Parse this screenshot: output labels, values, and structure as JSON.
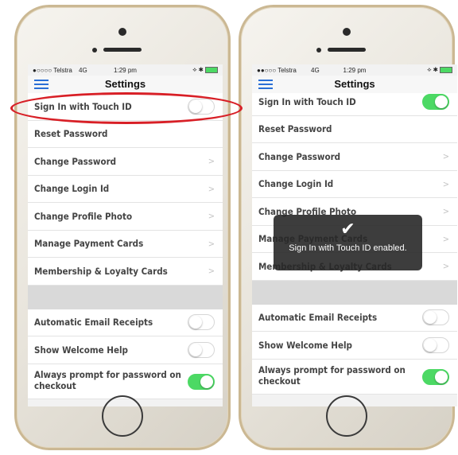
{
  "status": {
    "carrier": "●○○○○ Telstra",
    "network": "4G",
    "time": "1:29 pm",
    "icons": "⟡ ✱"
  },
  "status_right": {
    "carrier": "●●○○○ Telstra",
    "network": "4G",
    "time": "1:29 pm"
  },
  "navbar": {
    "title": "Settings"
  },
  "rows_left": [
    {
      "label": "Sign In with Touch ID",
      "control": "toggle-off"
    },
    {
      "label": "Reset Password",
      "control": "none"
    },
    {
      "label": "Change Password",
      "control": "chevron"
    },
    {
      "label": "Change Login Id",
      "control": "chevron"
    },
    {
      "label": "Change Profile Photo",
      "control": "chevron"
    },
    {
      "label": "Manage Payment Cards",
      "control": "chevron"
    },
    {
      "label": "Membership & Loyalty Cards",
      "control": "chevron"
    },
    {
      "label": "Automatic Email Receipts",
      "control": "toggle-off"
    },
    {
      "label": "Show Welcome Help",
      "control": "toggle-off"
    },
    {
      "label": "Always prompt for password on checkout",
      "control": "toggle-on"
    }
  ],
  "rows_right": [
    {
      "label": "Sign In with Touch ID",
      "control": "toggle-on"
    },
    {
      "label": "Reset Password",
      "control": "none"
    },
    {
      "label": "Change Password",
      "control": "chevron"
    },
    {
      "label": "Change Login Id",
      "control": "chevron"
    },
    {
      "label": "Change Profile Photo",
      "control": "chevron"
    },
    {
      "label": "Manage Payment Cards",
      "control": "chevron"
    },
    {
      "label": "Membership & Loyalty Cards",
      "control": "chevron"
    },
    {
      "label": "Automatic Email Receipts",
      "control": "toggle-off"
    },
    {
      "label": "Show Welcome Help",
      "control": "toggle-off"
    },
    {
      "label": "Always prompt for password on checkout",
      "control": "toggle-on"
    }
  ],
  "toast": {
    "icon": "checkmark-icon",
    "check": "✔",
    "message": "Sign In with Touch ID enabled."
  },
  "chevron": ">",
  "colors": {
    "toggle_on": "#4cd964",
    "highlight": "#d81f26",
    "menu": "#2a6fd6"
  }
}
